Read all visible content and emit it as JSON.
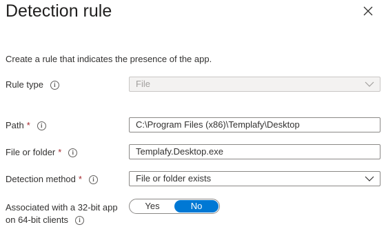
{
  "panel": {
    "title": "Detection rule",
    "description": "Create a rule that indicates the presence of the app."
  },
  "icons": {
    "close": "close-icon",
    "info": "info-icon",
    "chevron": "chevron-down-icon"
  },
  "fields": {
    "rule_type": {
      "label": "Rule type",
      "value": "File"
    },
    "path": {
      "label": "Path",
      "required": "*",
      "value": "C:\\Program Files (x86)\\Templafy\\Desktop"
    },
    "file_or_folder": {
      "label": "File or folder",
      "required": "*",
      "value": "Templafy.Desktop.exe"
    },
    "detection_method": {
      "label": "Detection method",
      "required": "*",
      "value": "File or folder exists"
    },
    "associated_32bit": {
      "label_line1": "Associated with a 32-bit app",
      "label_line2": "on 64-bit clients",
      "options": [
        "Yes",
        "No"
      ],
      "selected": "No"
    }
  },
  "colors": {
    "accent": "#0078d4",
    "required": "#a4262c"
  }
}
